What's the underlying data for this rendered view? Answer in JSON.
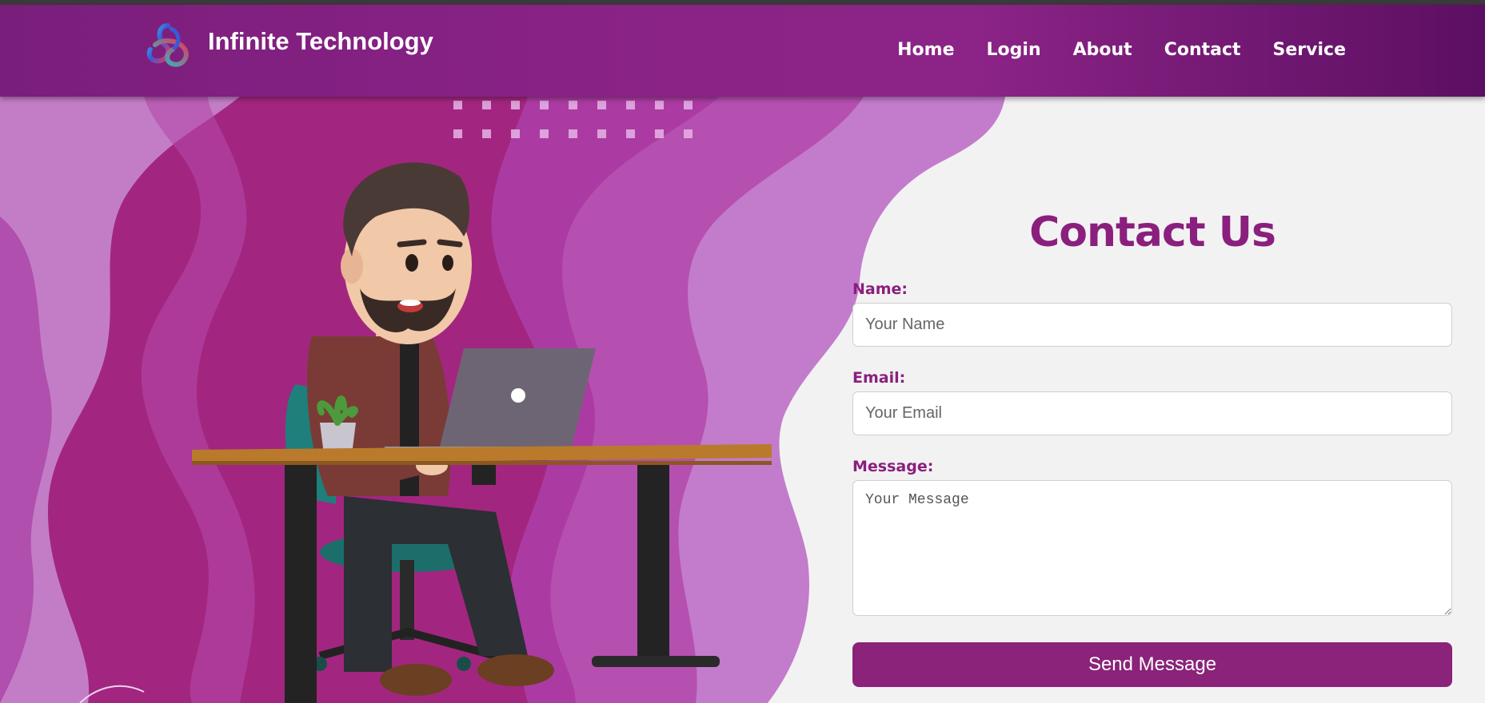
{
  "brand": {
    "title": "Infinite Technology",
    "logo_icon": "infinity-knot-icon"
  },
  "nav": {
    "items": [
      "Home",
      "Login",
      "About",
      "Contact",
      "Service"
    ]
  },
  "contact": {
    "heading": "Contact Us",
    "name_label": "Name:",
    "name_placeholder": "Your Name",
    "email_label": "Email:",
    "email_placeholder": "Your Email",
    "message_label": "Message:",
    "message_placeholder": "Your Message",
    "submit_label": "Send Message"
  },
  "colors": {
    "brand_purple": "#8a1f7d",
    "header_gradient_start": "#7a1e7c",
    "header_gradient_end": "#5c0f62",
    "hero_magenta": "#a2267f",
    "hero_light_purple": "#c283d0"
  }
}
